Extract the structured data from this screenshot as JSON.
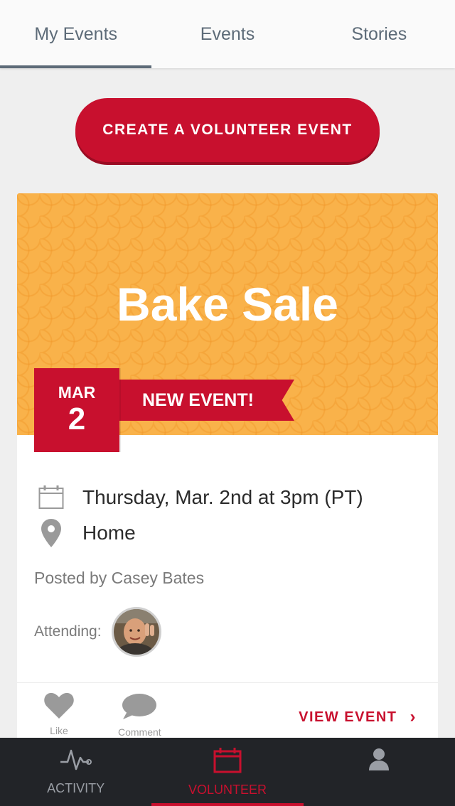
{
  "top_tabs": [
    {
      "label": "My Events",
      "active": true
    },
    {
      "label": "Events",
      "active": false
    },
    {
      "label": "Stories",
      "active": false
    }
  ],
  "create_button": {
    "label": "CREATE A VOLUNTEER EVENT"
  },
  "event": {
    "title": "Bake Sale",
    "badge_month": "MAR",
    "badge_day": "2",
    "ribbon": "NEW EVENT!",
    "datetime": "Thursday, Mar. 2nd at 3pm (PT)",
    "location": "Home",
    "posted_by": "Posted by Casey Bates",
    "attending_label": "Attending:",
    "like_label": "Like",
    "comment_label": "Comment",
    "view_event_label": "VIEW EVENT",
    "chevron": "›"
  },
  "bottom_nav": [
    {
      "label": "ACTIVITY",
      "icon": "activity-icon",
      "active": false
    },
    {
      "label": "VOLUNTEER",
      "icon": "calendar-icon",
      "active": true
    },
    {
      "label": "",
      "icon": "profile-icon",
      "active": false
    }
  ],
  "colors": {
    "accent": "#c8102e",
    "hero_bg": "#f9b24a",
    "tab_text": "#5d6b78",
    "nav_bg": "#222428"
  }
}
